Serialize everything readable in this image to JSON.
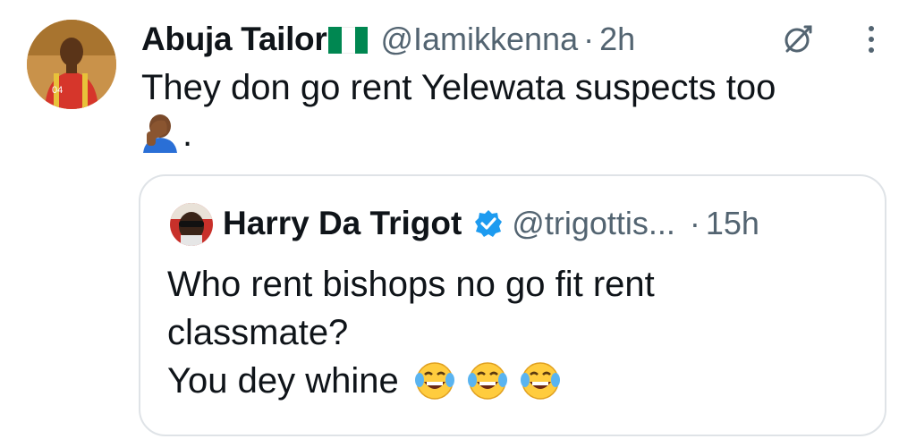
{
  "tweet": {
    "display_name": "Abuja Tailor",
    "handle": "@Iamikkenna",
    "separator": "·",
    "time": "2h",
    "text_line1": "They don go rent Yelewata suspects too",
    "text_suffix": ".",
    "flag_colors": [
      "#008751",
      "#ffffff",
      "#008751"
    ],
    "icons": [
      "nigeria-flag",
      "grok-icon",
      "more-options-icon",
      "facepalm-emoji"
    ]
  },
  "quote": {
    "display_name": "Harry Da Trigot",
    "handle": "@trigottis...",
    "separator": "·",
    "time": "15h",
    "line1": "Who rent bishops no go fit rent",
    "line2": "classmate?",
    "line3": "You dey whine",
    "verified_color": "#1d9bf0",
    "icons": [
      "verified-badge-icon",
      "tears-of-joy-emoji"
    ]
  },
  "colors": {
    "text": "#0f1419",
    "secondary": "#536471",
    "border": "#dfe3e7"
  }
}
